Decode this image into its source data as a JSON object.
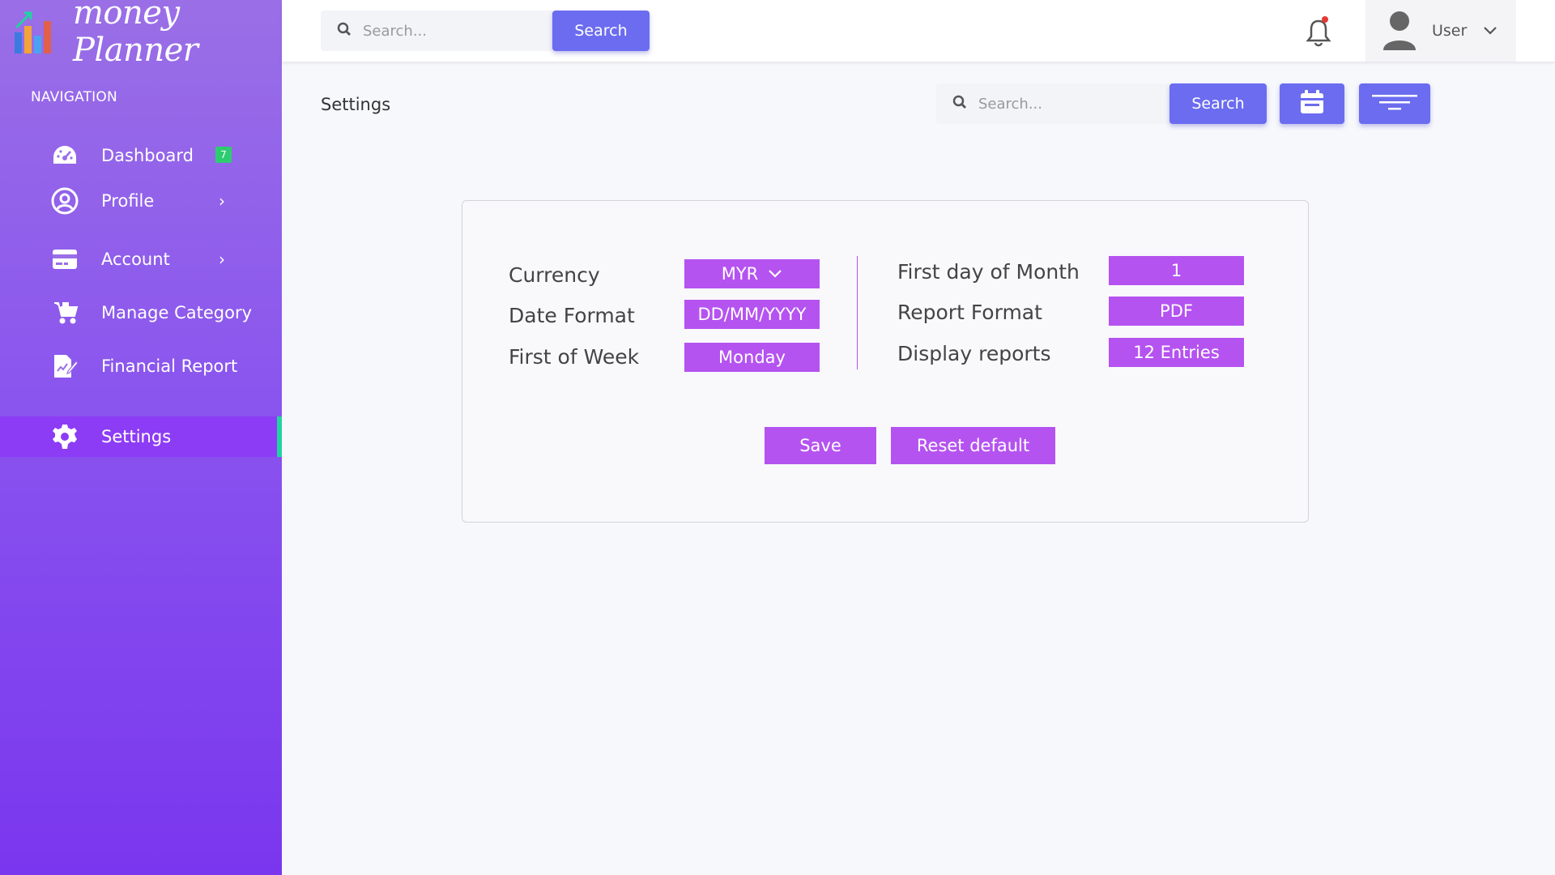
{
  "app": {
    "logo_text": "money Planner"
  },
  "sidebar": {
    "heading": "NAVIGATION",
    "items": [
      {
        "label": "Dashboard",
        "icon": "dashboard-gauge-icon",
        "badge": "7"
      },
      {
        "label": "Profile",
        "icon": "user-circle-icon",
        "chevron": "›"
      },
      {
        "label": "Account",
        "icon": "credit-card-icon",
        "chevron": "›"
      },
      {
        "label": "Manage Category",
        "icon": "stroller-icon"
      },
      {
        "label": "Financial Report",
        "icon": "report-edit-icon"
      },
      {
        "label": "Settings",
        "icon": "gear-icon",
        "active": true
      }
    ]
  },
  "topbar": {
    "search_placeholder": "Search...",
    "search_button": "Search",
    "notification_dot_color": "#e53935",
    "user_name": "User"
  },
  "page": {
    "title": "Settings",
    "search_placeholder": "Search...",
    "search_button": "Search"
  },
  "settings": {
    "left": [
      {
        "label": "Currency",
        "value": "MYR"
      },
      {
        "label": "Date Format",
        "value": "DD/MM/YYYY"
      },
      {
        "label": "First of Week",
        "value": "Monday"
      }
    ],
    "right": [
      {
        "label": "First day of Month",
        "value": "1"
      },
      {
        "label": "Report Format",
        "value": "PDF"
      },
      {
        "label": "Display reports",
        "value": "12 Entries"
      }
    ],
    "save_label": "Save",
    "reset_label": "Reset default"
  },
  "colors": {
    "accent_blue": "#6b6cf0",
    "accent_purple": "#b553f0",
    "active_indicator": "#22d3a1",
    "badge_green": "#2ecc71"
  }
}
